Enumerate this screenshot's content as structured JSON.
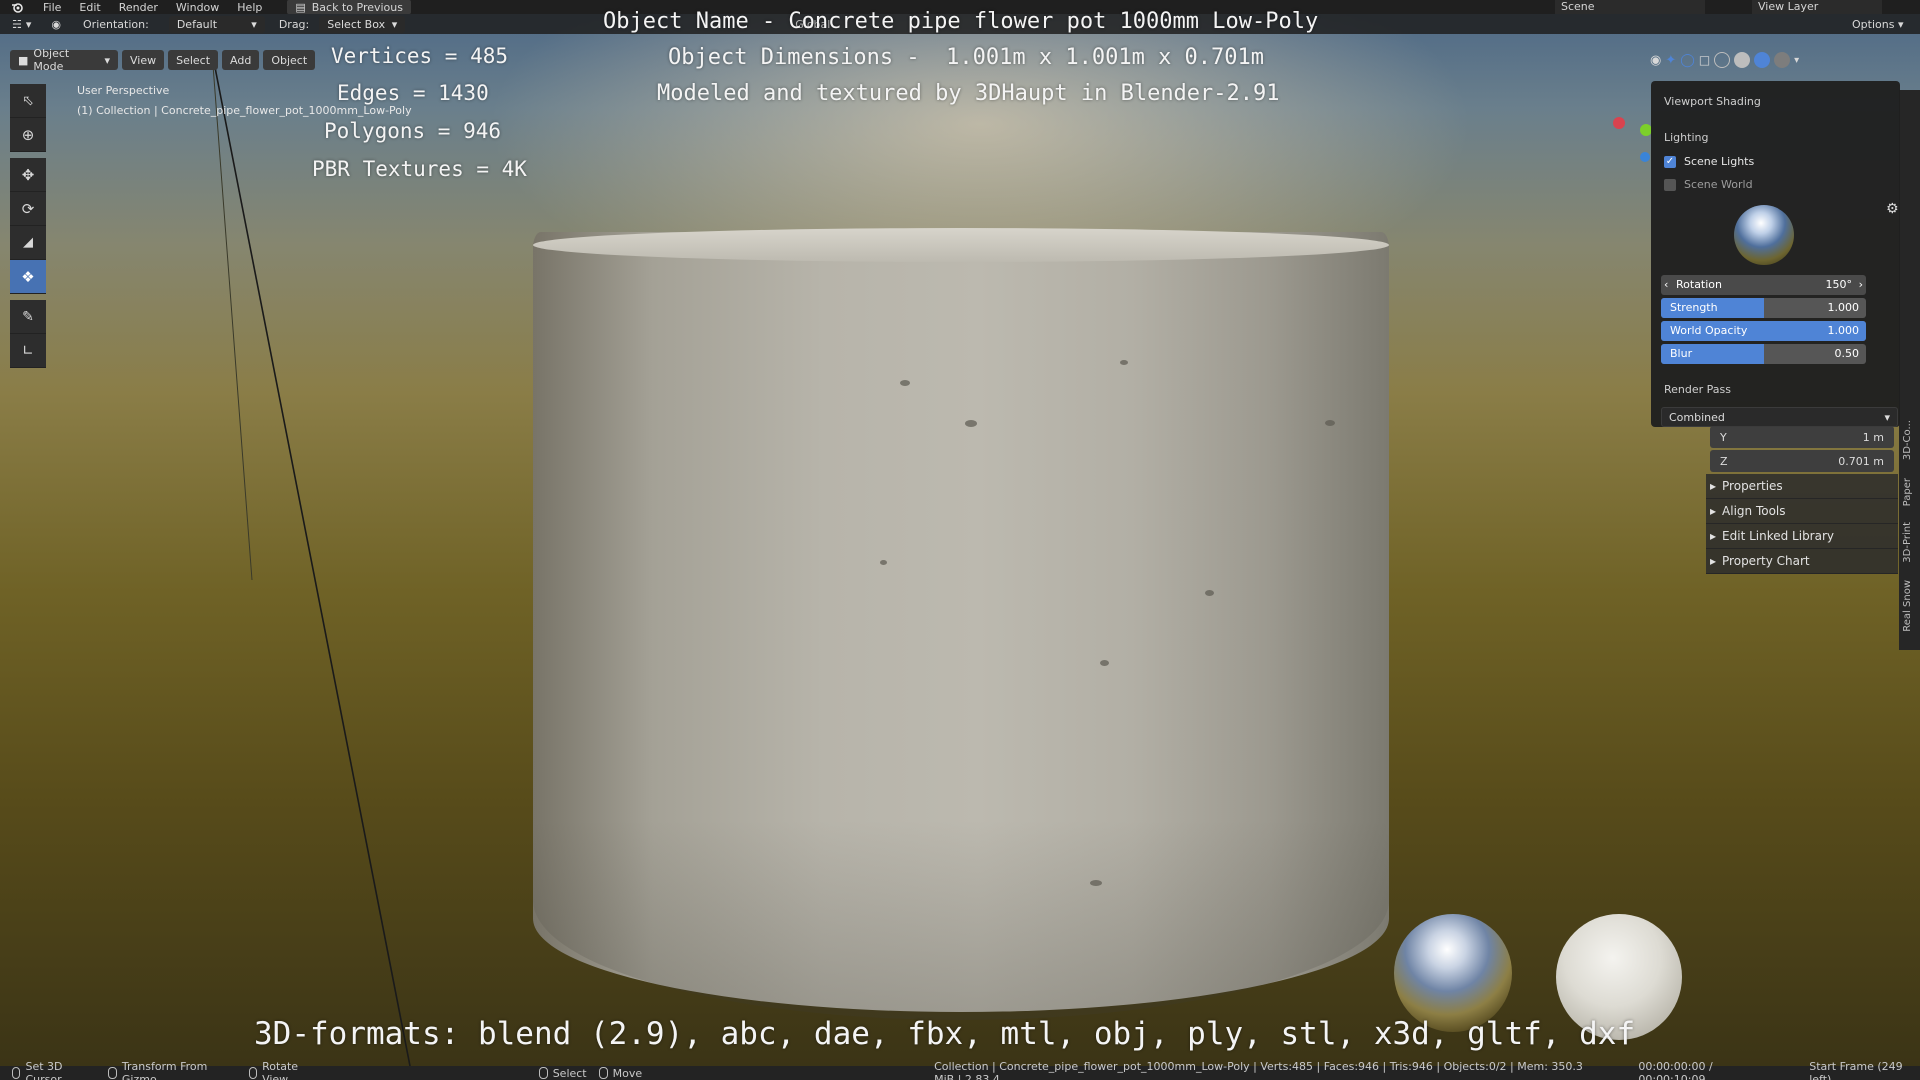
{
  "menubar": {
    "items": [
      "File",
      "Edit",
      "Render",
      "Window",
      "Help"
    ],
    "back_button": "Back to Previous",
    "scene": "Scene",
    "view_layer": "View Layer"
  },
  "header": {
    "orientation_label": "Orientation:",
    "orientation_value": "Default",
    "drag_label": "Drag:",
    "drag_value": "Select Box",
    "transform_space": "Global",
    "options": "Options"
  },
  "mode_bar": {
    "mode": "Object Mode",
    "menus": [
      "View",
      "Select",
      "Add",
      "Object"
    ]
  },
  "viewport": {
    "perspective": "User Perspective",
    "collection": "(1) Collection | Concrete_pipe_flower_pot_1000mm_Low-Poly"
  },
  "overlay": {
    "object_name": "Object Name - Concrete pipe flower pot 1000mm Low-Poly",
    "dimensions": "Object Dimensions -  1.001m x 1.001m x 0.701m",
    "credit": "Modeled and textured by 3DHaupt in Blender-2.91",
    "vertices": "Vertices = 485",
    "edges": "Edges = 1430",
    "polygons": "Polygons = 946",
    "textures": "PBR Textures = 4K",
    "formats": "3D-formats: blend (2.9), abc, dae, fbx, mtl, obj, ply, stl, x3d, gltf, dxf"
  },
  "shading_popover": {
    "title": "Viewport Shading",
    "lighting": "Lighting",
    "scene_lights": "Scene Lights",
    "scene_world": "Scene World",
    "rotation_label": "Rotation",
    "rotation_value": "150°",
    "strength_label": "Strength",
    "strength_value": "1.000",
    "strength_fill": 0.5,
    "world_opacity_label": "World Opacity",
    "world_opacity_value": "1.000",
    "world_opacity_fill": 1.0,
    "blur_label": "Blur",
    "blur_value": "0.50",
    "blur_fill": 0.5,
    "render_pass_label": "Render Pass",
    "render_pass_value": "Combined"
  },
  "n_panel": {
    "y_label": "Y",
    "y_value": "1 m",
    "z_label": "Z",
    "z_value": "0.701 m",
    "sections": [
      "Properties",
      "Align Tools",
      "Edit Linked Library",
      "Property Chart"
    ]
  },
  "side_tabs": [
    "3D-Co...",
    "Paper",
    "3D-Print",
    "Real Snow"
  ],
  "statusbar": {
    "left_items": [
      "Set 3D Cursor",
      "Transform From Gizmo",
      "Rotate View"
    ],
    "mid_items": [
      "Select",
      "Move"
    ],
    "stats": "Collection | Concrete_pipe_flower_pot_1000mm_Low-Poly | Verts:485 | Faces:946 | Tris:946 | Objects:0/2 | Mem: 350.3 MiB | 2.83.4",
    "time": "00:00:00:00 / 00:00:10:09",
    "frame": "Start Frame (249 left)"
  }
}
